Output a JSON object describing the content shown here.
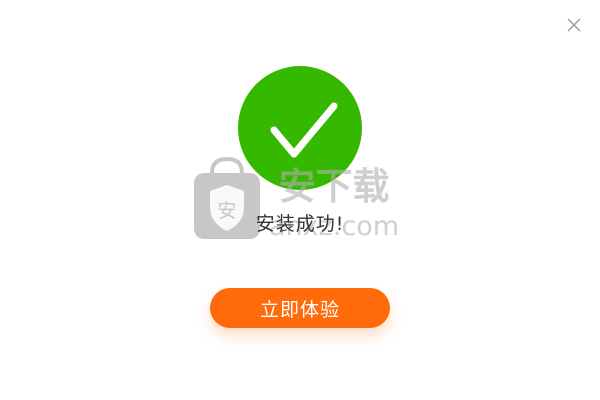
{
  "dialog": {
    "status_text": "安装成功!",
    "primary_button_label": "立即体验",
    "icons": {
      "close": "close-icon",
      "success": "checkmark-icon"
    },
    "watermark": {
      "brand_text": "安下载",
      "domain_text": "anxz.com",
      "badge_glyph": "安"
    }
  },
  "colors": {
    "success_green": "#35b800",
    "accent_orange": "#ff6a0a",
    "close_gray": "#9a9a9a",
    "text_dark": "#333333"
  }
}
